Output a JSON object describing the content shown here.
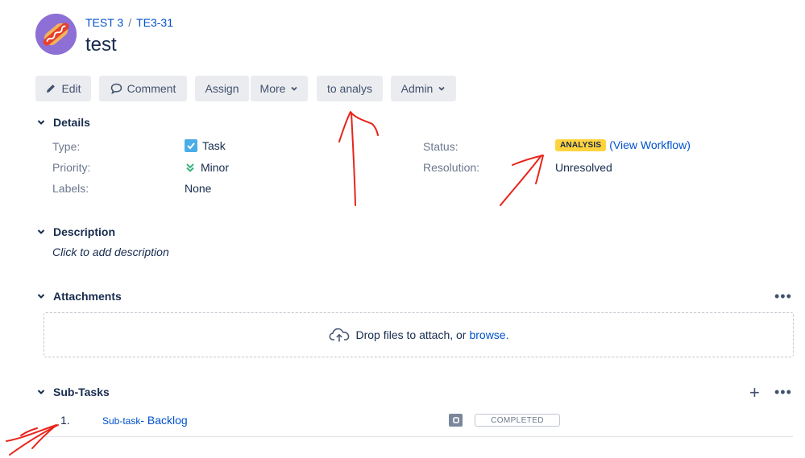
{
  "header": {
    "project": "TEST 3",
    "separator": "/",
    "issue_key": "TE3-31",
    "title": "test"
  },
  "toolbar": {
    "edit": "Edit",
    "comment": "Comment",
    "assign": "Assign",
    "more": "More",
    "transition": "to analys",
    "admin": "Admin"
  },
  "details": {
    "heading": "Details",
    "type_label": "Type:",
    "type_value": "Task",
    "priority_label": "Priority:",
    "priority_value": "Minor",
    "labels_label": "Labels:",
    "labels_value": "None",
    "status_label": "Status:",
    "status_value": "ANALYSIS",
    "view_workflow": "(View Workflow)",
    "resolution_label": "Resolution:",
    "resolution_value": "Unresolved"
  },
  "description": {
    "heading": "Description",
    "placeholder": "Click to add description"
  },
  "attachments": {
    "heading": "Attachments",
    "drop_text": "Drop files to attach, or",
    "browse": "browse."
  },
  "subtasks": {
    "heading": "Sub-Tasks",
    "items": [
      {
        "number": "1.",
        "type": "Sub-task",
        "summary": "- Backlog",
        "status": "COMPLETED"
      }
    ]
  },
  "colors": {
    "avatar_bg": "#8e6fd6",
    "link": "#0052cc",
    "status_lozenge": "#ffd33d",
    "annotation": "#e8251b"
  }
}
